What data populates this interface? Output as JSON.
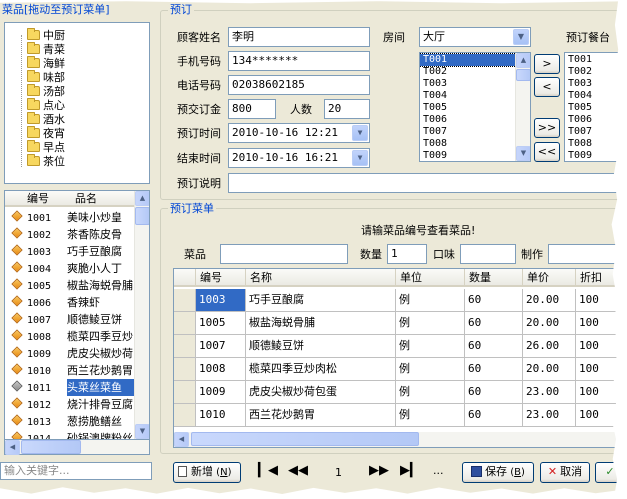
{
  "left_panel": {
    "title": "菜品[拖动至预订菜单]",
    "categories": [
      "中厨",
      "青菜",
      "海鲜",
      "味部",
      "汤部",
      "点心",
      "酒水",
      "夜宵",
      "早点",
      "茶位"
    ],
    "dish_columns": [
      "编号",
      "品名"
    ],
    "dishes": [
      {
        "id": "1001",
        "name": "美味小炒皇",
        "icon": "box-icon"
      },
      {
        "id": "1002",
        "name": "茶香陈皮骨",
        "icon": "box-icon"
      },
      {
        "id": "1003",
        "name": "巧手豆酿腐",
        "icon": "box-icon"
      },
      {
        "id": "1004",
        "name": "爽脆小人丁",
        "icon": "box-icon"
      },
      {
        "id": "1005",
        "name": "椒盐海蜕骨脯",
        "icon": "box-icon"
      },
      {
        "id": "1006",
        "name": "香辣虾",
        "icon": "box-icon"
      },
      {
        "id": "1007",
        "name": "顺德鲮豆饼",
        "icon": "box-icon"
      },
      {
        "id": "1008",
        "name": "榄菜四季豆炒",
        "icon": "box-icon"
      },
      {
        "id": "1009",
        "name": "虎皮尖椒炒荷",
        "icon": "box-icon"
      },
      {
        "id": "1010",
        "name": "西兰花炒鹅胃",
        "icon": "box-icon"
      },
      {
        "id": "1011",
        "name": "头菜丝菜鱼",
        "icon": "box-icon-grey"
      },
      {
        "id": "1012",
        "name": "烧汁排骨豆腐",
        "icon": "box-icon"
      },
      {
        "id": "1013",
        "name": "葱捞脆鳝丝",
        "icon": "box-icon"
      },
      {
        "id": "1014",
        "name": "砂锅澳牌粉丝",
        "icon": "box-icon"
      }
    ],
    "selected_dish": "1011",
    "search_placeholder": "输入关键字..."
  },
  "booking": {
    "title": "预订",
    "customer_label": "顾客姓名",
    "customer_value": "李明",
    "phone_label": "手机号码",
    "phone_value": "134*******",
    "tel_label": "电话号码",
    "tel_value": "02038602185",
    "deposit_label": "预交订金",
    "deposit_value": "800",
    "people_label": "人数",
    "people_value": "20",
    "time_label": "预订时间",
    "time_value": "2010-10-16 12:21",
    "end_label": "结束时间",
    "end_value": "2010-10-16 16:21",
    "note_label": "预订说明",
    "note_value": "",
    "room_label": "房间",
    "room_value": "大厅",
    "tables_available": [
      "T001",
      "T002",
      "T003",
      "T004",
      "T005",
      "T006",
      "T007",
      "T008",
      "T009"
    ],
    "tables_selected_label": "预订餐台",
    "tables_booked": [
      "T001",
      "T002",
      "T003",
      "T004",
      "T005",
      "T006",
      "T007",
      "T008",
      "T009"
    ],
    "btn_add_one": ">",
    "btn_remove_one": "<",
    "btn_add_all": ">>",
    "btn_remove_all": "<<"
  },
  "menu": {
    "title": "预订菜单",
    "hint": "请输菜品编号查看菜品!",
    "dish_label": "菜品",
    "qty_label": "数量",
    "qty_value": "1",
    "taste_label": "口味",
    "make_label": "制作",
    "columns": [
      "编号",
      "名称",
      "单位",
      "数量",
      "单价",
      "折扣"
    ],
    "rows": [
      [
        "1003",
        "巧手豆酿腐",
        "例",
        "60",
        "20.00",
        "100"
      ],
      [
        "1005",
        "椒盐海蜕骨脯",
        "例",
        "60",
        "20.00",
        "100"
      ],
      [
        "1007",
        "顺德鲮豆饼",
        "例",
        "60",
        "26.00",
        "100"
      ],
      [
        "1008",
        "榄菜四季豆炒肉松",
        "例",
        "60",
        "20.00",
        "100"
      ],
      [
        "1009",
        "虎皮尖椒炒荷包蛋",
        "例",
        "60",
        "23.00",
        "100"
      ],
      [
        "1010",
        "西兰花炒鹅胃",
        "例",
        "60",
        "23.00",
        "100"
      ]
    ]
  },
  "footer": {
    "new_label": "新增",
    "new_key": "N",
    "page_value": "1",
    "ellipsis": "...",
    "save_label": "保存",
    "save_key": "B",
    "cancel_label": "取消"
  }
}
